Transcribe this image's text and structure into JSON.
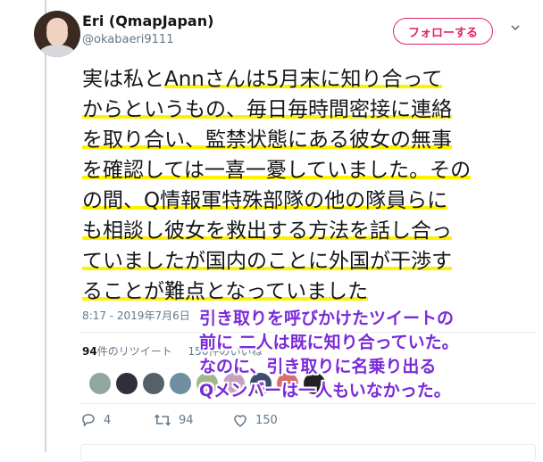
{
  "user": {
    "display_name": "Eri (QmapJapan)",
    "handle": "@okabaeri9111",
    "avatar_icon": "avatar-photo"
  },
  "follow_label": "フォローする",
  "tweet": {
    "lines": [
      {
        "plain": "実は私と",
        "marked": "Annさんは5月末に知り合って"
      },
      {
        "plain": "",
        "marked": "からというもの、毎日毎時間密接に連絡"
      },
      {
        "plain": "",
        "marked": "を取り合い、監禁状態にある彼女の無事"
      },
      {
        "plain": "",
        "marked": "を確認しては一喜一憂していました。その"
      },
      {
        "plain": "",
        "marked": "の間、Q情報軍特殊部隊の他の隊員らに"
      },
      {
        "plain": "",
        "marked": "も相談し彼女を救出する方法を話し合っ"
      },
      {
        "plain": "",
        "marked": "ていましたが国内のことに外国が干渉す"
      },
      {
        "plain": "",
        "marked": "ることが難点となっていました"
      }
    ],
    "timestamp": "8:17 - 2019年7月6日"
  },
  "stats": {
    "retweets_count": "94",
    "retweets_label": "件のリツイート",
    "likes_text": "150件のいいね"
  },
  "annotation": {
    "lines": [
      "引き取りを呼びかけたツイートの",
      "前に 二人は既に知り合っていた。",
      "なのに、引き取りに名乗り出る",
      "Qメンバーは一人もいなかった。"
    ]
  },
  "actions": {
    "reply_count": "4",
    "retweet_count": "94",
    "like_count": "150"
  },
  "colors": {
    "highlight": "#fff200",
    "annotation": "#7a2bd8",
    "follow": "#e0245e",
    "muted": "#657786"
  }
}
